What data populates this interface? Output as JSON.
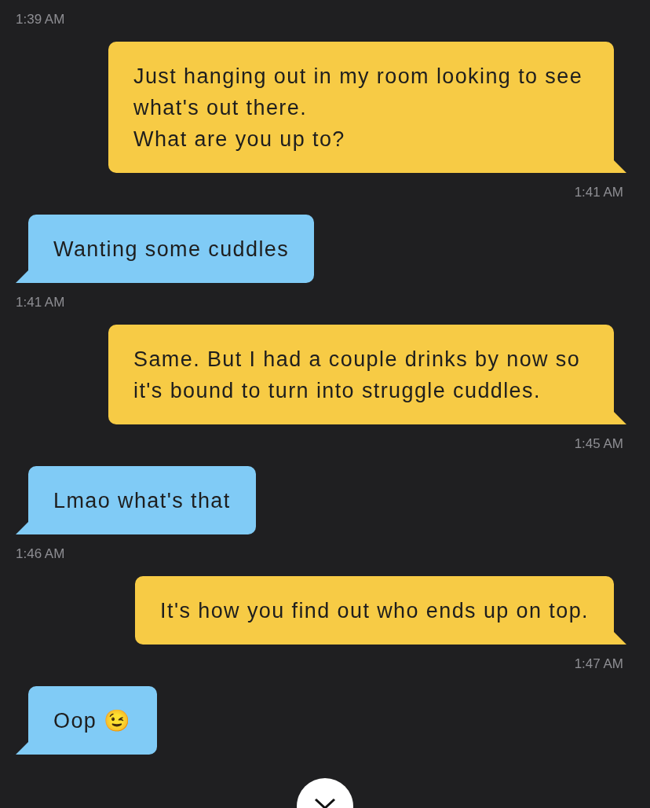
{
  "top_time": "1:39 AM",
  "messages": [
    {
      "kind": "sent",
      "text": "Just hanging out in my room looking to see what's out there.\nWhat are you up to?",
      "time": "1:41 AM"
    },
    {
      "kind": "received",
      "text": "Wanting some cuddles",
      "time": "1:41 AM"
    },
    {
      "kind": "sent",
      "text": "Same. But I had a couple drinks by now so it's bound to turn into struggle cuddles.",
      "time": "1:45 AM"
    },
    {
      "kind": "received",
      "text": "Lmao what's that",
      "time": "1:46 AM"
    },
    {
      "kind": "sent",
      "text": "It's how you find out who ends up on top.",
      "time": "1:47 AM"
    },
    {
      "kind": "received",
      "text": "Oop 😉"
    }
  ]
}
